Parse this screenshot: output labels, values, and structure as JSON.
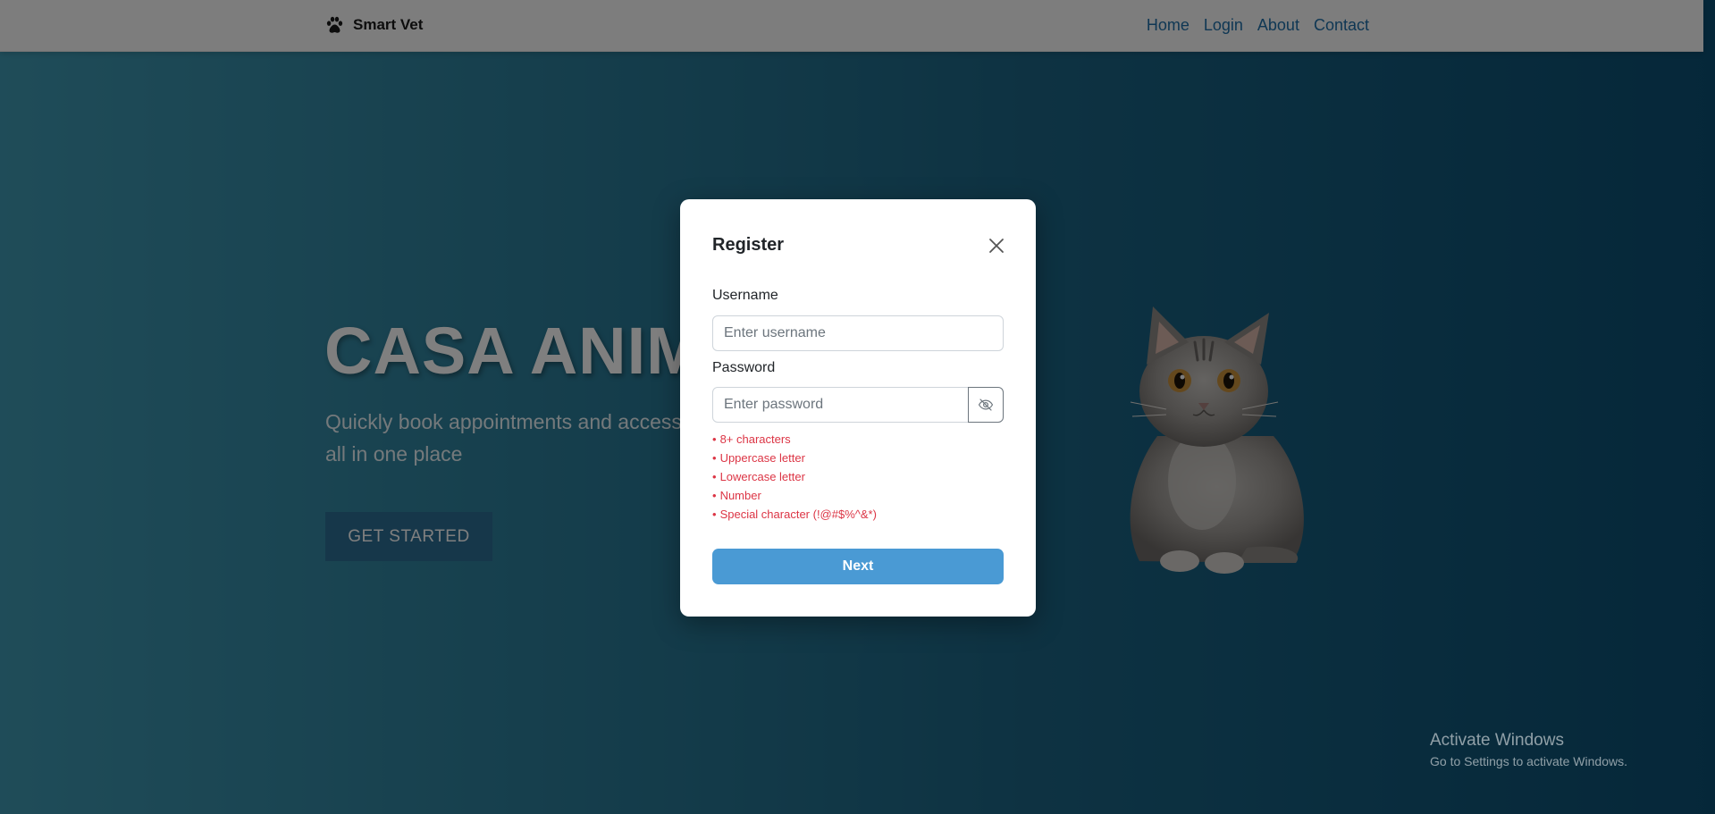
{
  "navbar": {
    "brand": "Smart Vet",
    "links": [
      {
        "label": "Home"
      },
      {
        "label": "Login"
      },
      {
        "label": "About"
      },
      {
        "label": "Contact"
      }
    ]
  },
  "hero": {
    "title": "CASA ANIMAL",
    "subtitle": "Quickly book appointments and access your pet's health information all in one place",
    "cta_label": "GET STARTED"
  },
  "modal": {
    "title": "Register",
    "username": {
      "label": "Username",
      "placeholder": "Enter username",
      "value": ""
    },
    "password": {
      "label": "Password",
      "placeholder": "Enter password",
      "value": ""
    },
    "requirements": [
      "8+ characters",
      "Uppercase letter",
      "Lowercase letter",
      "Number",
      "Special character (!@#$%^&*)"
    ],
    "next_label": "Next"
  },
  "watermark": {
    "title": "Activate Windows",
    "subtitle": "Go to Settings to activate Windows."
  },
  "icons": {
    "brand": "paw-icon",
    "close": "close-icon",
    "password_toggle": "eye-slash-icon"
  },
  "colors": {
    "nav_link": "#1f6fa8",
    "requirement_text": "#dc3545",
    "next_button": "#4a9ad4",
    "hero_gradient_start": "#3f99b2",
    "hero_gradient_end": "#0b4f73"
  }
}
